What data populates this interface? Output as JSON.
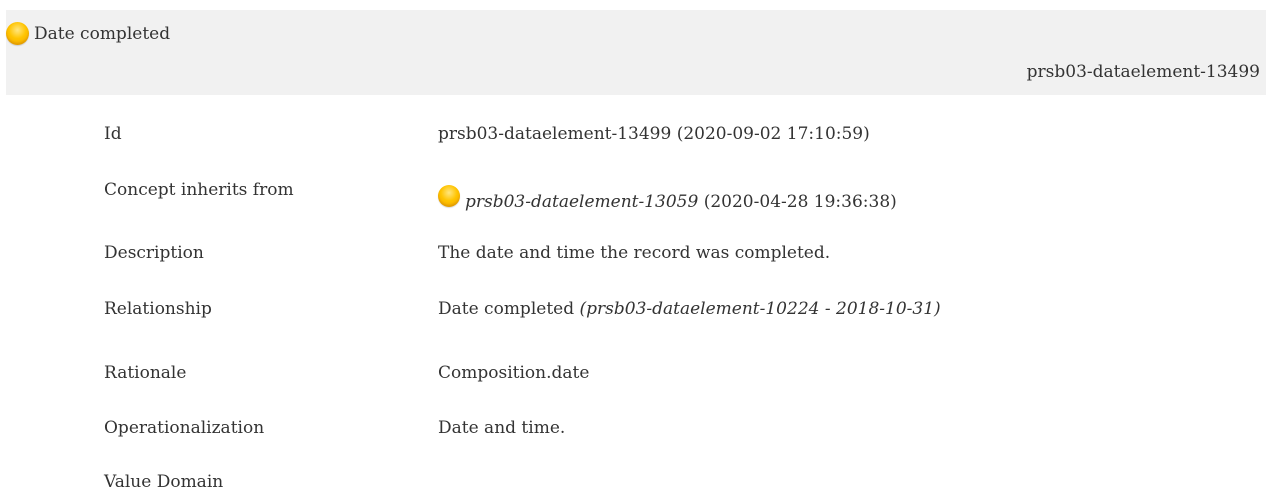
{
  "header": {
    "title": "Date completed",
    "id": "prsb03-dataelement-13499",
    "status_color": "#ffc400",
    "status_icon": "status-draft-icon"
  },
  "details": {
    "id": {
      "label": "Id",
      "value": "prsb03-dataelement-13499 (2020-09-02 17:10:59)"
    },
    "inherits": {
      "label": "Concept inherits from",
      "ref": "prsb03-dataelement-13059",
      "date": " (2020-04-28 19:36:38)"
    },
    "description": {
      "label": "Description",
      "value": "The date and time the record was completed."
    },
    "relationship": {
      "label": "Relationship",
      "name": "Date completed ",
      "ref": "(prsb03-dataelement-10224 - 2018-10-31)"
    },
    "rationale": {
      "label": "Rationale",
      "value": "Composition.date"
    },
    "operationalization": {
      "label": "Operationalization",
      "value": "Date and time."
    },
    "value_domain": {
      "label": "Value Domain"
    }
  }
}
